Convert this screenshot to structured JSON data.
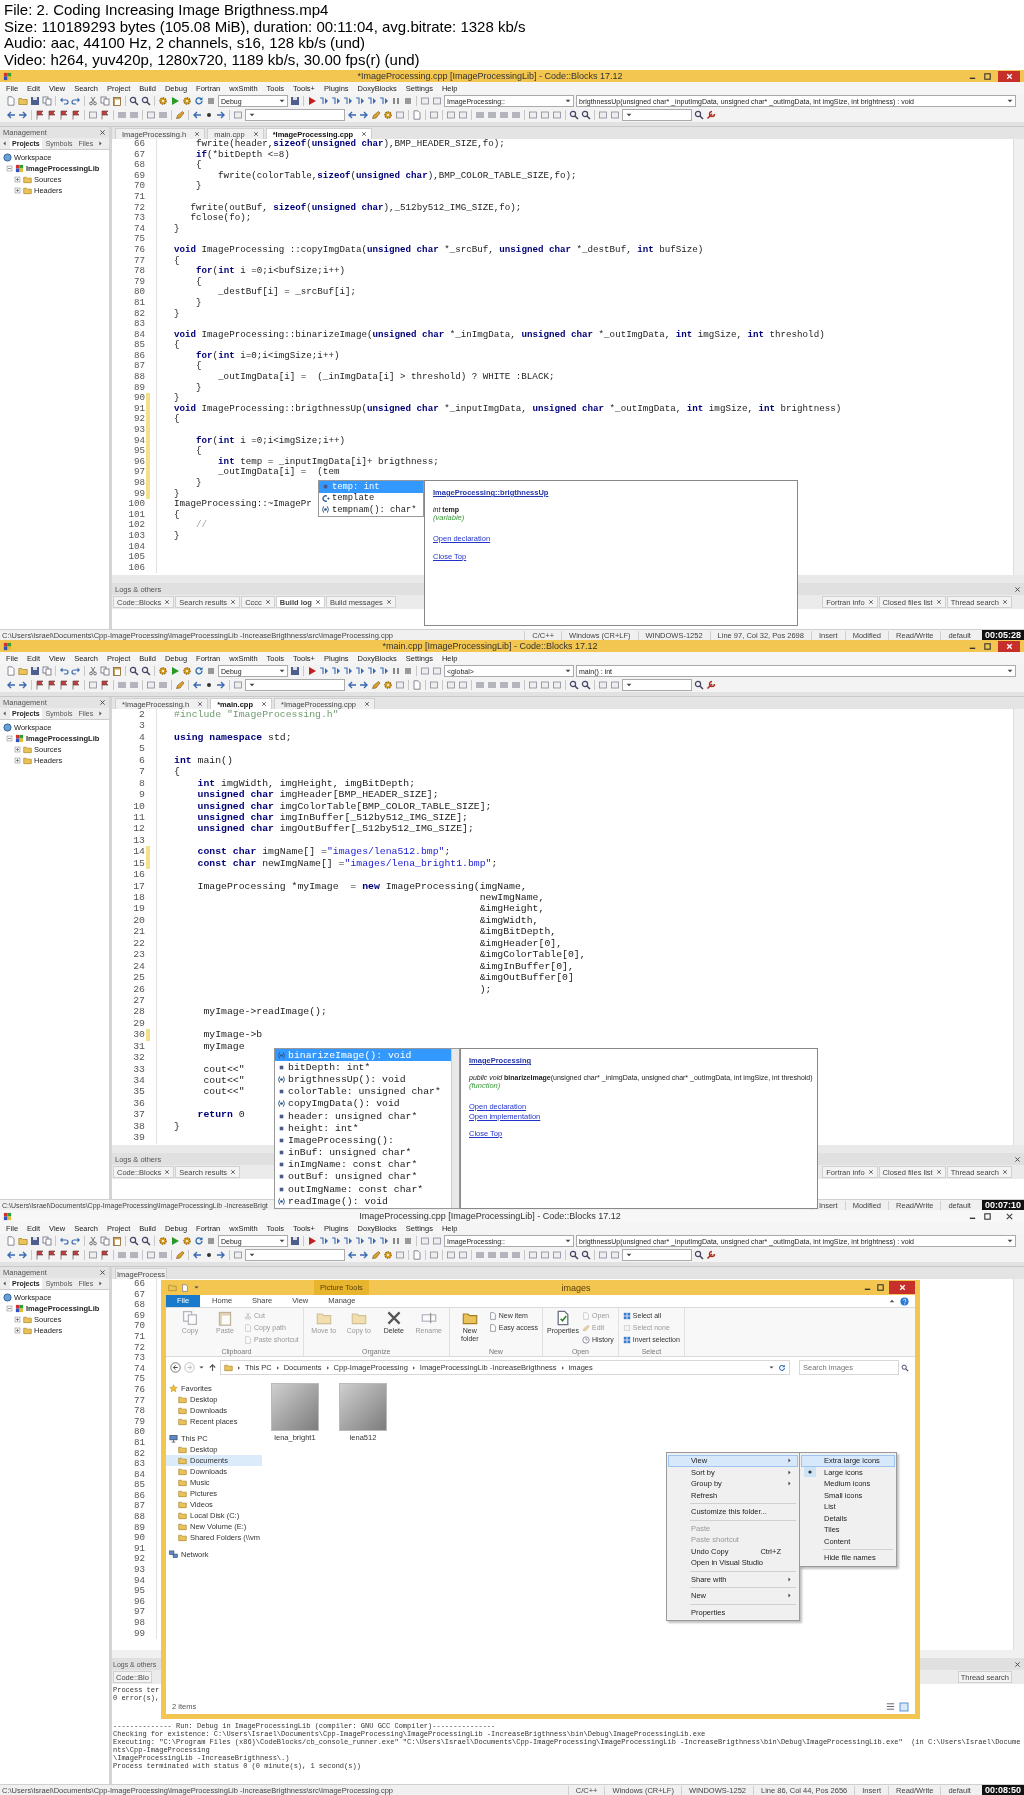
{
  "video_info": [
    "File: 2. Coding  Increasing Image Brigthness.mp4",
    "Size: 110189293 bytes (105.08 MiB), duration: 00:11:04, avg.bitrate: 1328 kb/s",
    "Audio: aac, 44100 Hz, 2 channels, s16, 128 kb/s (und)",
    "Video: h264, yuv420p, 1280x720, 1189 kb/s, 30.00 fps(r) (und)"
  ],
  "frames": [
    {
      "window": {
        "title": "*ImageProcessing.cpp [ImageProcessingLib] - Code::Blocks 17.12",
        "active": true
      },
      "menu": [
        "File",
        "Edit",
        "View",
        "Search",
        "Project",
        "Build",
        "Debug",
        "Fortran",
        "wxSmith",
        "Tools",
        "Tools+",
        "Plugins",
        "DoxyBlocks",
        "Settings",
        "Help"
      ],
      "toolbar": {
        "build_target": "Debug",
        "scope": "ImageProcessing::",
        "symbol": "brigthnessUp(unsigned char* _inputImgData, unsigned char* _outImgData, int imgSize, int brightness) : void"
      },
      "management": {
        "title": "Management",
        "tabs": [
          {
            "label": "Projects",
            "selected": true
          },
          {
            "label": "Symbols",
            "selected": false
          },
          {
            "label": "Files",
            "selected": false
          }
        ],
        "tree": [
          {
            "label": "Workspace",
            "children": [
              {
                "label": "ImageProcessingLib",
                "children": [
                  {
                    "label": "Sources"
                  },
                  {
                    "label": "Headers"
                  }
                ]
              }
            ]
          }
        ]
      },
      "editor_tabs": [
        {
          "label": "ImageProcessing.h",
          "selected": false
        },
        {
          "label": "main.cpp",
          "selected": false
        },
        {
          "label": "*ImageProcessing.cpp",
          "selected": true
        }
      ],
      "code": [
        {
          "number": "66",
          "changed": false,
          "segments": [
            "    fwrite(header,",
            {
              "kind": "keyword",
              "text": "sizeof"
            },
            "(",
            {
              "kind": "keyword",
              "text": "unsigned char"
            },
            "),BMP_HEADER_SIZE,fo);"
          ]
        },
        {
          "number": "67",
          "changed": false,
          "segments": [
            {
              "kind": "keyword",
              "text": "    if"
            },
            "(*bitDepth <=8)"
          ]
        },
        {
          "number": "68",
          "changed": false,
          "segments": [
            "    {"
          ]
        },
        {
          "number": "69",
          "changed": false,
          "segments": [
            "        fwrite(colorTable,",
            {
              "kind": "keyword",
              "text": "sizeof"
            },
            "(",
            {
              "kind": "keyword",
              "text": "unsigned char"
            },
            "),BMP_COLOR_TABLE_SIZE,fo);"
          ]
        },
        {
          "number": "70",
          "changed": false,
          "segments": [
            "    }"
          ]
        },
        {
          "number": "71",
          "changed": false
        },
        {
          "number": "72",
          "changed": false,
          "segments": [
            "   fwrite(outBuf, ",
            {
              "kind": "keyword",
              "text": "sizeof"
            },
            "(",
            {
              "kind": "keyword",
              "text": "unsigned char"
            },
            "),_512by512_IMG_SIZE,fo);"
          ]
        },
        {
          "number": "73",
          "changed": false,
          "segments": [
            "   fclose(fo);"
          ]
        },
        {
          "number": "74",
          "changed": false,
          "segments": [
            "}"
          ]
        },
        {
          "number": "75",
          "changed": false
        },
        {
          "number": "76",
          "changed": false,
          "segments": [
            {
              "kind": "keyword",
              "text": "void"
            },
            " ImageProcessing ::copyImgData(",
            {
              "kind": "keyword",
              "text": "unsigned char"
            },
            " *_srcBuf, ",
            {
              "kind": "keyword",
              "text": "unsigned char"
            },
            " *_destBuf, ",
            {
              "kind": "keyword",
              "text": "int"
            },
            " bufSize)"
          ]
        },
        {
          "number": "77",
          "changed": false,
          "segments": [
            "{"
          ]
        },
        {
          "number": "78",
          "changed": false,
          "segments": [
            {
              "kind": "keyword",
              "text": "    for"
            },
            "(",
            {
              "kind": "keyword",
              "text": "int"
            },
            " i =0;i<bufSize;i++)"
          ]
        },
        {
          "number": "79",
          "changed": false,
          "segments": [
            "    {"
          ]
        },
        {
          "number": "80",
          "changed": false,
          "segments": [
            "        _destBuf[i] = _srcBuf[i];"
          ]
        },
        {
          "number": "81",
          "changed": false,
          "segments": [
            "    }"
          ]
        },
        {
          "number": "82",
          "changed": false,
          "segments": [
            "}"
          ]
        },
        {
          "number": "83",
          "changed": false
        },
        {
          "number": "84",
          "changed": false,
          "segments": [
            {
              "kind": "keyword",
              "text": "void"
            },
            " ImageProcessing::binarizeImage(",
            {
              "kind": "keyword",
              "text": "unsigned char"
            },
            " *_inImgData, ",
            {
              "kind": "keyword",
              "text": "unsigned char"
            },
            " *_outImgData, ",
            {
              "kind": "keyword",
              "text": "int"
            },
            " imgSize, ",
            {
              "kind": "keyword",
              "text": "int"
            },
            " threshold)"
          ]
        },
        {
          "number": "85",
          "changed": false,
          "segments": [
            "{"
          ]
        },
        {
          "number": "86",
          "changed": false,
          "segments": [
            {
              "kind": "keyword",
              "text": "    for"
            },
            "(",
            {
              "kind": "keyword",
              "text": "int"
            },
            " i=0;i<imgSize;i++)"
          ]
        },
        {
          "number": "87",
          "changed": false,
          "segments": [
            "    {"
          ]
        },
        {
          "number": "88",
          "changed": false,
          "segments": [
            "        _outImgData[i] =  (_inImgData[i] > threshold) ? WHITE :BLACK;"
          ]
        },
        {
          "number": "89",
          "changed": false,
          "segments": [
            "    }"
          ]
        },
        {
          "number": "90",
          "changed": true,
          "segments": [
            "}"
          ]
        },
        {
          "number": "91",
          "changed": true,
          "segments": [
            {
              "kind": "keyword",
              "text": "void"
            },
            " ImageProcessing::brigthnessUp(",
            {
              "kind": "keyword",
              "text": "unsigned char"
            },
            " *_inputImgData, ",
            {
              "kind": "keyword",
              "text": "unsigned char"
            },
            " *_outImgData, ",
            {
              "kind": "keyword",
              "text": "int"
            },
            " imgSize, ",
            {
              "kind": "keyword",
              "text": "int"
            },
            " brightness)"
          ]
        },
        {
          "number": "92",
          "changed": true,
          "segments": [
            "{"
          ]
        },
        {
          "number": "93",
          "changed": true
        },
        {
          "number": "94",
          "changed": true,
          "segments": [
            {
              "kind": "keyword",
              "text": "    for"
            },
            "(",
            {
              "kind": "keyword",
              "text": "int"
            },
            " i =0;i<imgSize;i++)"
          ]
        },
        {
          "number": "95",
          "changed": true,
          "segments": [
            "    {"
          ]
        },
        {
          "number": "96",
          "changed": true,
          "segments": [
            {
              "kind": "keyword",
              "text": "        int"
            },
            " temp = _inputImgData[i]+ brigthness;"
          ]
        },
        {
          "number": "97",
          "changed": true,
          "segments": [
            "        _outImgData[i] =  (tem"
          ]
        },
        {
          "number": "98",
          "changed": true,
          "segments": [
            "    }"
          ]
        },
        {
          "number": "99",
          "changed": true,
          "segments": [
            "}"
          ]
        },
        {
          "number": "100",
          "changed": false,
          "segments": [
            "ImageProcessing::~ImagePr"
          ]
        },
        {
          "number": "101",
          "changed": false,
          "segments": [
            "{"
          ]
        },
        {
          "number": "102",
          "changed": false,
          "segments": [
            {
              "kind": "comment",
              "text": "    //"
            }
          ]
        },
        {
          "number": "103",
          "changed": false,
          "segments": [
            "}"
          ]
        },
        {
          "number": "104",
          "changed": false
        },
        {
          "number": "105",
          "changed": false
        },
        {
          "number": "106",
          "changed": false
        }
      ],
      "completion": {
        "items": [
          {
            "kind": "variable",
            "text": "temp: int",
            "selected": true
          },
          {
            "kind": "class",
            "text": "template",
            "selected": false
          },
          {
            "kind": "function",
            "text": "tempnam(): char*",
            "selected": false
          }
        ],
        "doc": {
          "scope": "ImageProcessing::brigthnessUp",
          "signature": {
            "prefix": "int",
            "name": "temp"
          },
          "note": "(variable)",
          "link_groups": [
            [
              "Open declaration"
            ],
            [
              "Close Top"
            ]
          ]
        }
      },
      "logs": {
        "title": "Logs & others",
        "tabs_left": [
          {
            "label": "Code::Blocks",
            "selected": false
          },
          {
            "label": "Search results",
            "selected": false
          },
          {
            "label": "Cccc",
            "selected": false
          },
          {
            "label": "Build log",
            "selected": true
          },
          {
            "label": "Build messages",
            "selected": false
          }
        ],
        "tabs_right": [
          {
            "label": "Fortran info",
            "selected": false
          },
          {
            "label": "Closed files list",
            "selected": false
          },
          {
            "label": "Thread search",
            "selected": false
          }
        ]
      },
      "status": {
        "path": "C:\\Users\\Israel\\Documents\\Cpp-ImageProcessing\\ImageProcessingLib -IncreaseBrigthness\\src\\ImageProcessing.cpp",
        "items": [
          "C/C++",
          "Windows (CR+LF)",
          "WINDOWS-1252",
          "Line 97, Col 32, Pos 2698",
          "Insert",
          "Modified",
          "Read/Write",
          "default"
        ]
      },
      "timestamp": "00:05:28"
    },
    {
      "window": {
        "title": "*main.cpp [ImageProcessingLib] - Code::Blocks 17.12",
        "active": true
      },
      "menu": [
        "File",
        "Edit",
        "View",
        "Search",
        "Project",
        "Build",
        "Debug",
        "Fortran",
        "wxSmith",
        "Tools",
        "Tools+",
        "Plugins",
        "DoxyBlocks",
        "Settings",
        "Help"
      ],
      "toolbar": {
        "build_target": "Debug",
        "scope": "<global>",
        "symbol": "main() : int"
      },
      "management": {
        "title": "Management",
        "tabs": [
          {
            "label": "Projects",
            "selected": true
          },
          {
            "label": "Symbols",
            "selected": false
          },
          {
            "label": "Files",
            "selected": false
          }
        ],
        "tree": [
          {
            "label": "Workspace",
            "children": [
              {
                "label": "ImageProcessingLib",
                "children": [
                  {
                    "label": "Sources"
                  },
                  {
                    "label": "Headers"
                  }
                ]
              }
            ]
          }
        ]
      },
      "editor_tabs": [
        {
          "label": "*ImageProcessing.h",
          "selected": false
        },
        {
          "label": "*main.cpp",
          "selected": true
        },
        {
          "label": "*ImageProcessing.cpp",
          "selected": false
        }
      ],
      "code": [
        {
          "number": "2",
          "changed": false,
          "segments": [
            {
              "kind": "preprocessor",
              "text": "#include \"ImageProcessing.h\""
            }
          ]
        },
        {
          "number": "3",
          "changed": false
        },
        {
          "number": "4",
          "changed": false,
          "segments": [
            {
              "kind": "keyword",
              "text": "using namespace"
            },
            " std;"
          ]
        },
        {
          "number": "5",
          "changed": false
        },
        {
          "number": "6",
          "changed": false,
          "segments": [
            {
              "kind": "keyword",
              "text": "int"
            },
            " main()"
          ]
        },
        {
          "number": "7",
          "changed": false,
          "segments": [
            "{"
          ]
        },
        {
          "number": "8",
          "changed": false,
          "segments": [
            {
              "kind": "keyword",
              "text": "    int"
            },
            " imgWidth, imgHeight, imgBitDepth;"
          ]
        },
        {
          "number": "9",
          "changed": false,
          "segments": [
            {
              "kind": "keyword",
              "text": "    unsigned char"
            },
            " imgHeader[BMP_HEADER_SIZE];"
          ]
        },
        {
          "number": "10",
          "changed": false,
          "segments": [
            {
              "kind": "keyword",
              "text": "    unsigned char"
            },
            " imgColorTable[BMP_COLOR_TABLE_SIZE];"
          ]
        },
        {
          "number": "11",
          "changed": false,
          "segments": [
            {
              "kind": "keyword",
              "text": "    unsigned char"
            },
            " imgInBuffer[_512by512_IMG_SIZE];"
          ]
        },
        {
          "number": "12",
          "changed": false,
          "segments": [
            {
              "kind": "keyword",
              "text": "    unsigned char"
            },
            " imgOutBuffer[_512by512_IMG_SIZE];"
          ]
        },
        {
          "number": "13",
          "changed": false
        },
        {
          "number": "14",
          "changed": true,
          "segments": [
            {
              "kind": "keyword",
              "text": "    const char"
            },
            " imgName[] =",
            {
              "kind": "string",
              "text": "\"images/lena512.bmp\""
            },
            ";"
          ]
        },
        {
          "number": "15",
          "changed": true,
          "segments": [
            {
              "kind": "keyword",
              "text": "    const char"
            },
            " newImgName[] =",
            {
              "kind": "string",
              "text": "\"images/lena_bright1.bmp\""
            },
            ";"
          ]
        },
        {
          "number": "16",
          "changed": false
        },
        {
          "number": "17",
          "changed": false,
          "segments": [
            "    ImageProcessing *myImage  = ",
            {
              "kind": "keyword",
              "text": "new"
            },
            " ImageProcessing(imgName,"
          ]
        },
        {
          "number": "18",
          "changed": false,
          "segments": [
            "                                                    newImgName,"
          ]
        },
        {
          "number": "19",
          "changed": false,
          "segments": [
            "                                                    &imgHeight,"
          ]
        },
        {
          "number": "20",
          "changed": false,
          "segments": [
            "                                                    &imgWidth,"
          ]
        },
        {
          "number": "21",
          "changed": false,
          "segments": [
            "                                                    &imgBitDepth,"
          ]
        },
        {
          "number": "22",
          "changed": false,
          "segments": [
            "                                                    &imgHeader[0],"
          ]
        },
        {
          "number": "23",
          "changed": false,
          "segments": [
            "                                                    &imgColorTable[0],"
          ]
        },
        {
          "number": "24",
          "changed": false,
          "segments": [
            "                                                    &imgInBuffer[0],"
          ]
        },
        {
          "number": "25",
          "changed": false,
          "segments": [
            "                                                    &imgOutBuffer[0]"
          ]
        },
        {
          "number": "26",
          "changed": false,
          "segments": [
            "                                                    );"
          ]
        },
        {
          "number": "27",
          "changed": false
        },
        {
          "number": "28",
          "changed": false,
          "segments": [
            "     myImage->readImage();"
          ]
        },
        {
          "number": "29",
          "changed": false
        },
        {
          "number": "30",
          "changed": true,
          "segments": [
            "     myImage->b"
          ]
        },
        {
          "number": "31",
          "changed": false,
          "segments": [
            "     myImage"
          ]
        },
        {
          "number": "32",
          "changed": false
        },
        {
          "number": "33",
          "changed": false,
          "segments": [
            "     cout<<\""
          ]
        },
        {
          "number": "34",
          "changed": false,
          "segments": [
            "     cout<<\""
          ]
        },
        {
          "number": "35",
          "changed": false,
          "segments": [
            "     cout<<\""
          ]
        },
        {
          "number": "36",
          "changed": false
        },
        {
          "number": "37",
          "changed": false,
          "segments": [
            {
              "kind": "keyword",
              "text": "    return"
            },
            " 0"
          ]
        },
        {
          "number": "38",
          "changed": false,
          "segments": [
            "}"
          ]
        },
        {
          "number": "39",
          "changed": false
        }
      ],
      "completion": {
        "items": [
          {
            "kind": "function",
            "text": "binarizeImage(): void",
            "selected": true
          },
          {
            "kind": "variable",
            "text": "bitDepth: int*",
            "selected": false
          },
          {
            "kind": "function",
            "text": "brigthnessUp(): void",
            "selected": false
          },
          {
            "kind": "variable",
            "text": "colorTable: unsigned char*",
            "selected": false
          },
          {
            "kind": "function",
            "text": "copyImgData(): void",
            "selected": false
          },
          {
            "kind": "variable",
            "text": "header: unsigned char*",
            "selected": false
          },
          {
            "kind": "variable",
            "text": "height: int*",
            "selected": false
          },
          {
            "kind": "variable",
            "text": "ImageProcessing():",
            "selected": false
          },
          {
            "kind": "variable",
            "text": "inBuf: unsigned char*",
            "selected": false
          },
          {
            "kind": "variable",
            "text": "inImgName: const char*",
            "selected": false
          },
          {
            "kind": "variable",
            "text": "outBuf: unsigned char*",
            "selected": false
          },
          {
            "kind": "variable",
            "text": "outImgName: const char*",
            "selected": false
          },
          {
            "kind": "function",
            "text": "readImage(): void",
            "selected": false
          }
        ],
        "doc": {
          "scope": "ImageProcessing",
          "signature": {
            "prefix": "public void",
            "name": "binarizeImage",
            "params": "(unsigned char* _inImgData, unsigned char* _outImgData, int imgSize, int threshold)"
          },
          "note": "(function)",
          "link_groups": [
            [
              "Open declaration",
              "Open implementation"
            ],
            [
              "Close Top"
            ]
          ]
        }
      },
      "logs": {
        "title": "Logs & others",
        "tabs_left": [
          {
            "label": "Code::Blocks",
            "selected": false
          },
          {
            "label": "Search results",
            "selected": false
          }
        ],
        "tabs_right": [
          {
            "label": "Fortran info",
            "selected": false
          },
          {
            "label": "Closed files list",
            "selected": false
          },
          {
            "label": "Thread search",
            "selected": false
          }
        ]
      },
      "status": {
        "path": "C:\\Users\\Israel\\Documents\\Cpp-ImageProcessing\\ImageProcessingLib -IncreaseBrigt",
        "items": [
          "Insert",
          "Modified",
          "Read/Write",
          "default"
        ]
      },
      "timestamp": "00:07:10"
    },
    {
      "window": {
        "title": "ImageProcessing.cpp [ImageProcessingLib] - Code::Blocks 17.12",
        "active": false
      },
      "menu": [
        "File",
        "Edit",
        "View",
        "Search",
        "Project",
        "Build",
        "Debug",
        "Fortran",
        "wxSmith",
        "Tools",
        "Tools+",
        "Plugins",
        "DoxyBlocks",
        "Settings",
        "Help"
      ],
      "toolbar": {
        "build_target": "Debug",
        "scope": "ImageProcessing::",
        "symbol": "brigthnessUp(unsigned char* _inputImgData, unsigned char* _outImgData, int imgSize, int brightness) : void"
      },
      "management": {
        "title": "Management",
        "tabs": [
          {
            "label": "Projects",
            "selected": true
          },
          {
            "label": "Symbols",
            "selected": false
          },
          {
            "label": "Files",
            "selected": false
          }
        ],
        "tree": [
          {
            "label": "Workspace",
            "children": [
              {
                "label": "ImageProcessingLib",
                "children": [
                  {
                    "label": "Sources"
                  },
                  {
                    "label": "Headers"
                  }
                ]
              }
            ]
          }
        ]
      },
      "editor_tabs": [
        {
          "label": "ImageProcess",
          "selected": false
        }
      ],
      "code": [
        {
          "number": "66",
          "changed": false
        },
        {
          "number": "67",
          "changed": false
        },
        {
          "number": "68",
          "changed": false
        },
        {
          "number": "69",
          "changed": false
        },
        {
          "number": "70",
          "changed": false
        },
        {
          "number": "71",
          "changed": false
        },
        {
          "number": "72",
          "changed": false
        },
        {
          "number": "73",
          "changed": false
        },
        {
          "number": "74",
          "changed": false
        },
        {
          "number": "75",
          "changed": false
        },
        {
          "number": "76",
          "changed": false
        },
        {
          "number": "77",
          "changed": false
        },
        {
          "number": "78",
          "changed": false
        },
        {
          "number": "79",
          "changed": false
        },
        {
          "number": "80",
          "changed": false
        },
        {
          "number": "81",
          "changed": false
        },
        {
          "number": "82",
          "changed": false
        },
        {
          "number": "83",
          "changed": false
        },
        {
          "number": "84",
          "changed": false
        },
        {
          "number": "85",
          "changed": false
        },
        {
          "number": "86",
          "changed": false
        },
        {
          "number": "87",
          "changed": false
        },
        {
          "number": "88",
          "changed": false
        },
        {
          "number": "89",
          "changed": false
        },
        {
          "number": "90",
          "changed": false
        },
        {
          "number": "91",
          "changed": false
        },
        {
          "number": "92",
          "changed": false
        },
        {
          "number": "93",
          "changed": false
        },
        {
          "number": "94",
          "changed": false
        },
        {
          "number": "95",
          "changed": false
        },
        {
          "number": "96",
          "changed": false
        },
        {
          "number": "97",
          "changed": false
        },
        {
          "number": "98",
          "changed": false
        },
        {
          "number": "99",
          "changed": false
        }
      ],
      "logs": {
        "title": "Logs & others",
        "tabs_left": [
          {
            "label": "Code::Blo",
            "selected": false
          }
        ],
        "tabs_right": [
          {
            "label": "Thread search",
            "selected": false
          }
        ],
        "lines": [
          "Process ter",
          "0 error(s),",
          "-------------- Run: Debug in ImageProcessingLib (compiler: GNU GCC Compiler)---------------",
          "Checking for existence: C:\\Users\\Israel\\Documents\\Cpp-ImageProcessing\\ImageProcessingLib -IncreaseBrigthness\\bin\\Debug\\ImageProcessingLib.exe",
          "Executing: \"C:\\Program Files (x86)\\CodeBlocks/cb_console_runner.exe\" \"C:\\Users\\Israel\\Documents\\Cpp-ImageProcessing\\ImageProcessingLib -IncreaseBrigthness\\bin\\Debug\\ImageProcessingLib.exe\"  (in C:\\Users\\Israel\\Documents\\Cpp-ImageProcessing",
          "\\ImageProcessingLib -IncreaseBrigthness\\.)",
          "Process terminated with status 0 (0 minute(s), 1 second(s))"
        ]
      },
      "status": {
        "path": "C:\\Users\\Israel\\Documents\\Cpp-ImageProcessing\\ImageProcessingLib -IncreaseBrigthness\\src\\ImageProcessing.cpp",
        "items": [
          "C/C++",
          "Windows (CR+LF)",
          "WINDOWS-1252",
          "Line 86, Col 44, Pos 2656",
          "Insert",
          "Read/Write",
          "default"
        ]
      },
      "timestamp": "00:08:50",
      "explorer": {
        "title": "images",
        "contextual_tab": "Picture Tools",
        "ribbon_tabs": [
          {
            "kind": "menu",
            "label": "File"
          },
          {
            "kind": "tab",
            "label": "Home"
          },
          {
            "kind": "tab",
            "label": "Share"
          },
          {
            "kind": "tab",
            "label": "View"
          },
          {
            "kind": "tab",
            "label": "Manage"
          }
        ],
        "ribbon_groups": [
          {
            "label": "Clipboard",
            "buttons": [
              {
                "kind": "large",
                "label": "Copy",
                "disabled": true
              },
              {
                "kind": "large",
                "label": "Paste",
                "disabled": true
              },
              {
                "kind": "small",
                "label": "Cut",
                "disabled": true
              },
              {
                "kind": "small",
                "label": "Copy path",
                "disabled": true
              },
              {
                "kind": "small",
                "label": "Paste shortcut",
                "disabled": true
              }
            ]
          },
          {
            "label": "Organize",
            "buttons": [
              {
                "kind": "large",
                "label": "Move to",
                "disabled": true
              },
              {
                "kind": "large",
                "label": "Copy to",
                "disabled": true
              },
              {
                "kind": "large",
                "label": "Delete",
                "disabled": false
              },
              {
                "kind": "large",
                "label": "Rename",
                "disabled": true
              }
            ]
          },
          {
            "label": "New",
            "buttons": [
              {
                "kind": "large",
                "label": "New folder",
                "disabled": false
              },
              {
                "kind": "small",
                "label": "New item",
                "disabled": false
              },
              {
                "kind": "small",
                "label": "Easy access",
                "disabled": false
              }
            ]
          },
          {
            "label": "Open",
            "buttons": [
              {
                "kind": "large",
                "label": "Properties",
                "disabled": false
              },
              {
                "kind": "small",
                "label": "Open",
                "disabled": true
              },
              {
                "kind": "small",
                "label": "Edit",
                "disabled": true
              },
              {
                "kind": "small",
                "label": "History",
                "disabled": false
              }
            ]
          },
          {
            "label": "Select",
            "buttons": [
              {
                "kind": "small",
                "label": "Select all",
                "disabled": false
              },
              {
                "kind": "small",
                "label": "Select none",
                "disabled": true
              },
              {
                "kind": "small",
                "label": "Invert selection",
                "disabled": false
              }
            ]
          }
        ],
        "address": [
          "This PC",
          "Documents",
          "Cpp-ImageProcessing",
          "ImageProcessingLib -IncreaseBrigthness",
          "images"
        ],
        "search": {
          "placeholder": "Search images"
        },
        "nav": [
          {
            "label": "Favorites",
            "selected": false,
            "children": [
              {
                "label": "Desktop",
                "selected": false
              },
              {
                "label": "Downloads",
                "selected": false
              },
              {
                "label": "Recent places",
                "selected": false
              }
            ]
          },
          {
            "label": "This PC",
            "selected": false,
            "children": [
              {
                "label": "Desktop",
                "selected": false
              },
              {
                "label": "Documents",
                "selected": true
              },
              {
                "label": "Downloads",
                "selected": false
              },
              {
                "label": "Music",
                "selected": false
              },
              {
                "label": "Pictures",
                "selected": false
              },
              {
                "label": "Videos",
                "selected": false
              },
              {
                "label": "Local Disk (C:)",
                "selected": false
              },
              {
                "label": "New Volume (E:)",
                "selected": false
              },
              {
                "label": "Shared Folders (\\\\vm",
                "selected": false
              }
            ]
          },
          {
            "label": "Network",
            "selected": false
          }
        ],
        "files": [
          {
            "name": "lena_bright1"
          },
          {
            "name": "lena512"
          }
        ],
        "status": "2 items",
        "context_menu": [
          {
            "kind": "item",
            "label": "View",
            "submenu": true,
            "disabled": false,
            "highlighted": true
          },
          {
            "kind": "item",
            "label": "Sort by",
            "submenu": true,
            "disabled": false,
            "highlighted": false
          },
          {
            "kind": "item",
            "label": "Group by",
            "submenu": true,
            "disabled": false,
            "highlighted": false
          },
          {
            "kind": "item",
            "label": "Refresh",
            "submenu": false,
            "disabled": false,
            "highlighted": false
          },
          {
            "kind": "separator"
          },
          {
            "kind": "item",
            "label": "Customize this folder...",
            "submenu": false,
            "disabled": false,
            "highlighted": false
          },
          {
            "kind": "separator"
          },
          {
            "kind": "item",
            "label": "Paste",
            "submenu": false,
            "disabled": true,
            "highlighted": false
          },
          {
            "kind": "item",
            "label": "Paste shortcut",
            "submenu": false,
            "disabled": true,
            "highlighted": false
          },
          {
            "kind": "item",
            "label": "Undo Copy",
            "shortcut": "Ctrl+Z",
            "submenu": false,
            "disabled": false,
            "highlighted": false
          },
          {
            "kind": "item",
            "label": "Open in Visual Studio",
            "submenu": false,
            "disabled": false,
            "highlighted": false
          },
          {
            "kind": "separator"
          },
          {
            "kind": "item",
            "label": "Share with",
            "submenu": true,
            "disabled": false,
            "highlighted": false
          },
          {
            "kind": "separator"
          },
          {
            "kind": "item",
            "label": "New",
            "submenu": true,
            "disabled": false,
            "highlighted": false
          },
          {
            "kind": "separator"
          },
          {
            "kind": "item",
            "label": "Properties",
            "submenu": false,
            "disabled": false,
            "highlighted": false
          }
        ],
        "view_submenu": [
          {
            "kind": "item",
            "label": "Extra large icons",
            "highlighted": true,
            "selected": false
          },
          {
            "kind": "item",
            "label": "Large icons",
            "highlighted": false,
            "selected": true
          },
          {
            "kind": "item",
            "label": "Medium icons",
            "highlighted": false,
            "selected": false
          },
          {
            "kind": "item",
            "label": "Small icons",
            "highlighted": false,
            "selected": false
          },
          {
            "kind": "item",
            "label": "List",
            "highlighted": false,
            "selected": false
          },
          {
            "kind": "item",
            "label": "Details",
            "highlighted": false,
            "selected": false
          },
          {
            "kind": "item",
            "label": "Tiles",
            "highlighted": false,
            "selected": false
          },
          {
            "kind": "item",
            "label": "Content",
            "highlighted": false,
            "selected": false
          },
          {
            "kind": "separator"
          },
          {
            "kind": "item",
            "label": "Hide file names",
            "highlighted": false,
            "selected": false
          }
        ]
      }
    }
  ]
}
